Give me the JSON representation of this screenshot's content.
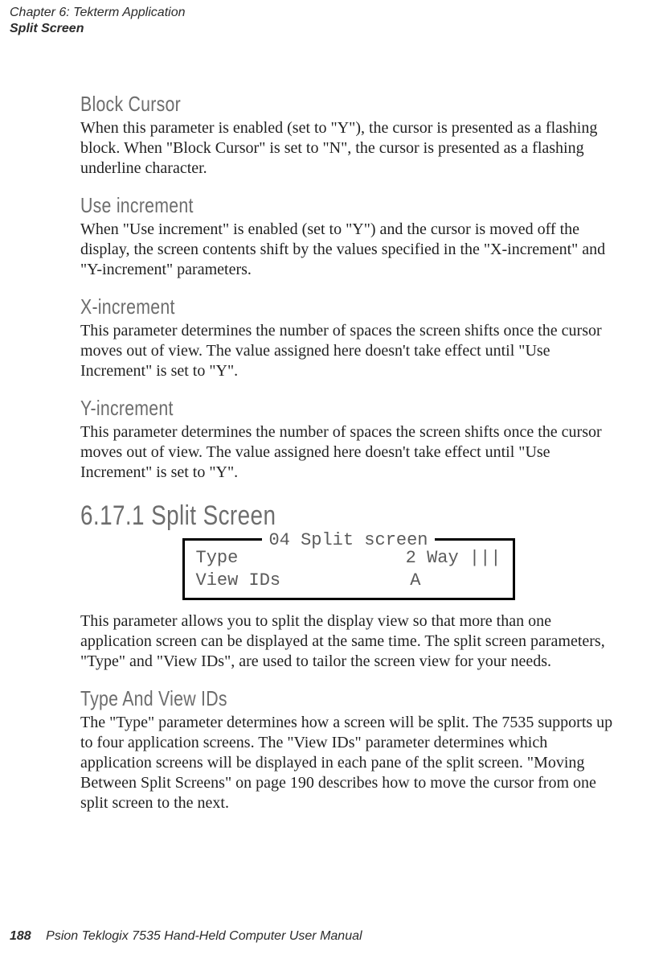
{
  "header": {
    "chapter": "Chapter 6: Tekterm Application",
    "section": "Split Screen"
  },
  "sections": {
    "block_cursor": {
      "title": "Block Cursor",
      "para": "When this parameter is enabled (set to \"Y\"), the cursor is presented as a flashing block. When \"Block Cursor\" is set to \"N\", the cursor is presented as a flashing underline character."
    },
    "use_increment": {
      "title": "Use increment",
      "para": "When \"Use increment\" is enabled (set to \"Y\") and the cursor is moved off the display, the screen contents shift by the values specified in the \"X-increment\" and \"Y-increment\" parameters."
    },
    "x_increment": {
      "title": "X-increment",
      "para": "This parameter determines the number of spaces the screen shifts once the cursor moves out of view. The value assigned here doesn't take effect until \"Use Increment\" is set to \"Y\"."
    },
    "y_increment": {
      "title": "Y-increment",
      "para": "This parameter determines the number of spaces the screen shifts once the cursor moves out of view. The value assigned here doesn't take effect until \"Use Increment\" is set to \"Y\"."
    },
    "split_screen": {
      "title": "6.17.1  Split Screen",
      "box_title": "04  Split screen",
      "row1_label": "Type",
      "row1_value": "2 Way |||",
      "row2_label": "View IDs",
      "row2_value": "A",
      "para": "This parameter allows you to split the display view so that more than one application screen can be displayed at the same time. The split screen parameters, \"Type\" and \"View IDs\", are used to tailor the screen view for your needs."
    },
    "type_view_ids": {
      "title": "Type And View IDs",
      "para": "The \"Type\" parameter determines how a screen will be split. The 7535 supports up to four application screens. The \"View IDs\" parameter determines which application screens will be displayed in each pane of the split screen. \"Moving Between Split Screens\" on page 190 describes how to move the cursor from one split screen to the next."
    }
  },
  "footer": {
    "page_number": "188",
    "book_title": "Psion Teklogix 7535 Hand-Held Computer User Manual"
  }
}
